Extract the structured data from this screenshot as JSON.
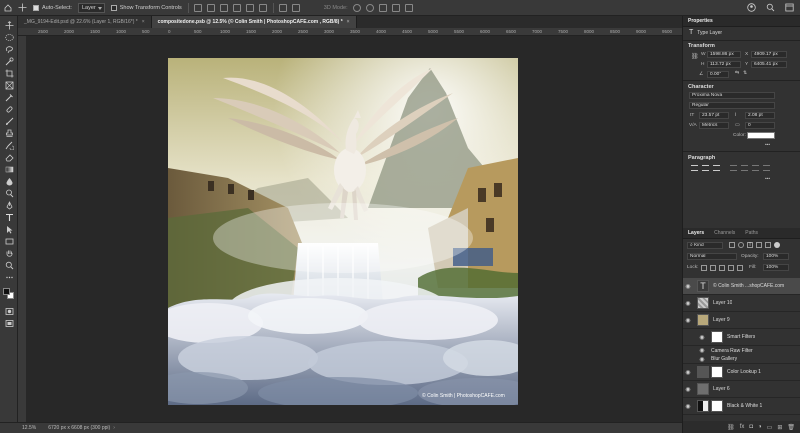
{
  "options_bar": {
    "auto_select_label": "Auto-Select:",
    "auto_select_value": "Layer",
    "transform_label": "Show Transform Controls",
    "mode_3d": "3D Mode:"
  },
  "tabs": [
    {
      "label": "_MG_9194-Edit.psd @ 22.6% (Layer 1, RGB/16*) *",
      "close": "×"
    },
    {
      "label": "compositedone.psb @ 12.5% (© Colin Smith | PhotoshopCAFE.com , RGB/8) *",
      "close": "×"
    }
  ],
  "ruler": [
    "2500",
    "2000",
    "1500",
    "1000",
    "500",
    "0",
    "500",
    "1000",
    "1500",
    "2000",
    "2500",
    "3000",
    "3500",
    "4000",
    "4500",
    "5000",
    "5500",
    "6000",
    "6500",
    "7000",
    "7500",
    "8000",
    "8500",
    "9000",
    "9500"
  ],
  "canvas": {
    "watermark": "© Colin Smith | PhotoshopCAFE.com"
  },
  "status": {
    "zoom": "12.5%",
    "doc_size": "6720 px x 6608 px (300 ppi)"
  },
  "panel": {
    "properties_tab": "Properties",
    "type_layer": "Type Layer",
    "transform_title": "Transform",
    "w_label": "W",
    "w_value": "1598.86 px",
    "x_label": "X",
    "x_value": "4909.17 px",
    "h_label": "H",
    "h_value": "113.72 px",
    "y_label": "Y",
    "y_value": "6405.41 px",
    "angle_value": "0.00°",
    "character_title": "Character",
    "font_family": "Proxima Nova",
    "font_style": "Regular",
    "font_size": "23.57 pt",
    "leading": "2.08 pt",
    "kerning": "Metrics",
    "tracking": "0",
    "color_label": "Color:",
    "paragraph_title": "Paragraph",
    "layer_tabs": [
      "Layers",
      "Channels",
      "Paths"
    ],
    "filter_kind": "Kind",
    "blend_mode": "Normal",
    "opacity_label": "Opacity:",
    "opacity_value": "100%",
    "lock_label": "Lock:",
    "fill_label": "Fill:",
    "fill_value": "100%",
    "layers": [
      {
        "name": "© Colin Smith ...shopCAFE.com",
        "type": "text",
        "selected": true
      },
      {
        "name": "Layer 10",
        "type": "pixel"
      },
      {
        "name": "Layer 9",
        "type": "smart"
      },
      {
        "name": "Smart Filters",
        "type": "filter-mask"
      },
      {
        "name": "Camera Raw Filter",
        "type": "filter"
      },
      {
        "name": "Blur Gallery",
        "type": "filter"
      },
      {
        "name": "Color Lookup 1",
        "type": "adjustment"
      },
      {
        "name": "Layer 6",
        "type": "pixel"
      },
      {
        "name": "Black & White 1",
        "type": "adjustment"
      }
    ]
  },
  "colors": {
    "app_bg": "#282828",
    "panel_bg": "#323232",
    "selected_row": "#4a4a4a",
    "sky_top": "#d8d2a0",
    "cloud": "#c8cfdc"
  }
}
